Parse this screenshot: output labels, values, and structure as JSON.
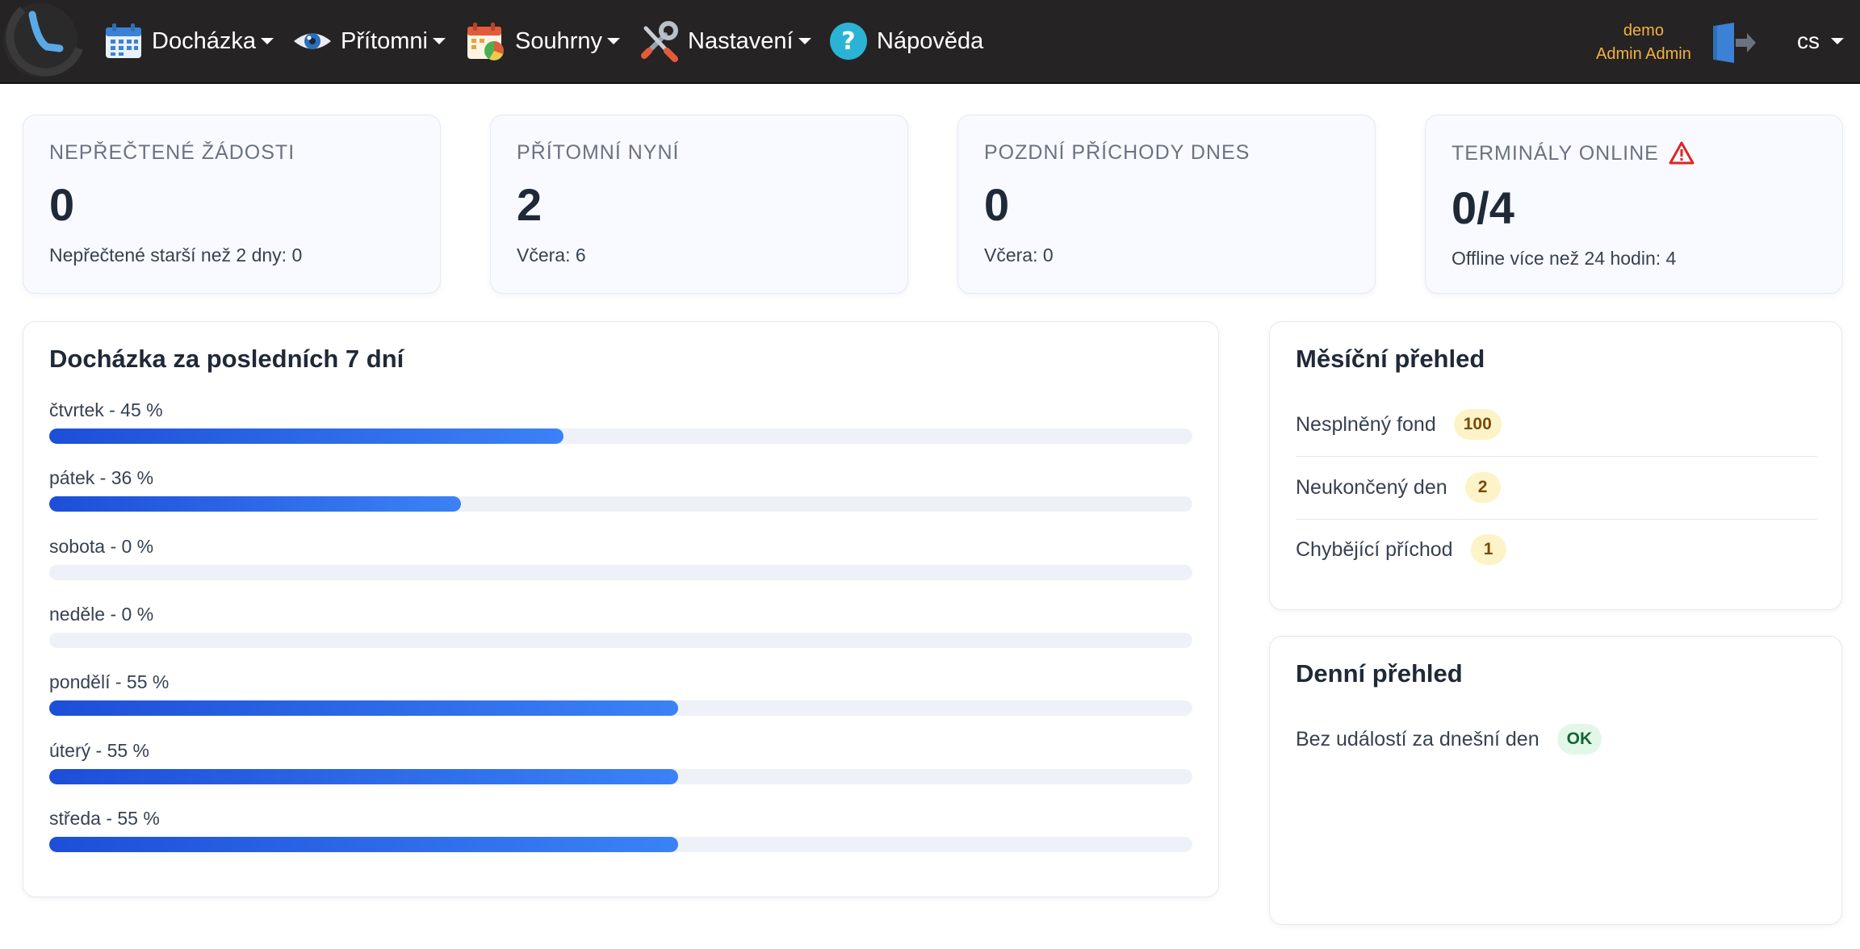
{
  "navbar": {
    "items": [
      {
        "label": "Docházka",
        "icon": "calendar-icon"
      },
      {
        "label": "Přítomni",
        "icon": "eye-icon"
      },
      {
        "label": "Souhrny",
        "icon": "report-calendar-icon"
      },
      {
        "label": "Nastavení",
        "icon": "tools-icon"
      },
      {
        "label": "Nápověda",
        "icon": "help-icon"
      }
    ],
    "user": {
      "login": "demo",
      "name": "Admin Admin"
    },
    "language": "cs"
  },
  "stats": [
    {
      "title": "NEPŘEČTENÉ ŽÁDOSTI",
      "value": "0",
      "sub": "Nepřečtené starší než 2 dny: 0"
    },
    {
      "title": "PŘÍTOMNÍ NYNÍ",
      "value": "2",
      "sub": "Včera: 6"
    },
    {
      "title": "POZDNÍ PŘÍCHODY DNES",
      "value": "0",
      "sub": "Včera: 0"
    },
    {
      "title": "TERMINÁLY ONLINE",
      "value": "0/4",
      "sub": "Offline více než 24 hodin: 4"
    }
  ],
  "attendance": {
    "title": "Docházka za posledních 7 dní",
    "days": [
      {
        "label": "čtvrtek - 45 %",
        "percent": 45
      },
      {
        "label": "pátek - 36 %",
        "percent": 36
      },
      {
        "label": "sobota - 0 %",
        "percent": 0
      },
      {
        "label": "neděle - 0 %",
        "percent": 0
      },
      {
        "label": "pondělí - 55 %",
        "percent": 55
      },
      {
        "label": "úterý - 55 %",
        "percent": 55
      },
      {
        "label": "středa - 55 %",
        "percent": 55
      }
    ]
  },
  "monthly": {
    "title": "Měsíční přehled",
    "rows": [
      {
        "label": "Nesplněný fond",
        "count": "100"
      },
      {
        "label": "Neukončený den",
        "count": "2"
      },
      {
        "label": "Chybějící příchod",
        "count": "1"
      }
    ]
  },
  "daily": {
    "title": "Denní přehled",
    "rows": [
      {
        "label": "Bez událostí za dnešní den",
        "status": "OK"
      }
    ]
  },
  "colors": {
    "navbar_bg": "#252323",
    "bar_fill": "#2563eb",
    "badge_warn": "#fdf3c8",
    "badge_ok": "#e3f7e8",
    "user_text": "#f5b041"
  }
}
